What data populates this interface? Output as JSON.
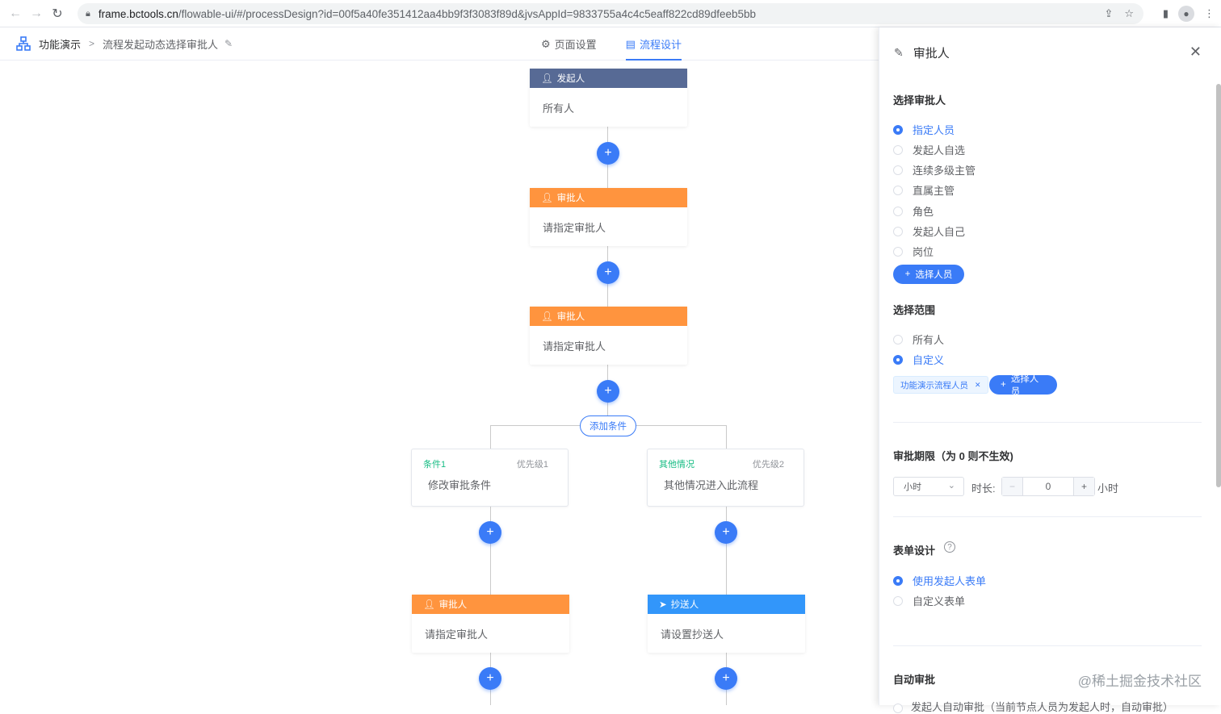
{
  "browser": {
    "url_host": "frame.bctools.cn",
    "url_rest": "/flowable-ui/#/processDesign?id=00f5a40fe351412aa4bb9f3f3083f89d&jvsAppId=9833755a4c4c5eaff822cd89dfeeb5bb"
  },
  "header": {
    "app_name": "功能演示",
    "current_page": "流程发起动态选择审批人",
    "tabs": [
      {
        "label": "页面设置",
        "icon": "gear-icon"
      },
      {
        "label": "流程设计",
        "icon": "flow-icon"
      }
    ]
  },
  "flow": {
    "start": {
      "type_label": "发起人",
      "content": "所有人"
    },
    "approver1": {
      "type_label": "审批人",
      "content": "请指定审批人"
    },
    "approver2": {
      "type_label": "审批人",
      "content": "请指定审批人"
    },
    "add_condition_label": "添加条件",
    "conditions": [
      {
        "title": "条件1",
        "priority": "优先级1",
        "content": "修改审批条件"
      },
      {
        "title": "其他情况",
        "priority": "优先级2",
        "content": "其他情况进入此流程"
      }
    ],
    "branch_left": {
      "type_label": "审批人",
      "content": "请指定审批人"
    },
    "branch_right": {
      "type_label": "抄送人",
      "content": "请设置抄送人"
    },
    "add_symbol": "+"
  },
  "panel": {
    "title": "审批人",
    "select_approver": {
      "title": "选择审批人",
      "options": [
        "指定人员",
        "发起人自选",
        "连续多级主管",
        "直属主管",
        "角色",
        "发起人自己",
        "岗位"
      ],
      "selected_index": 0,
      "button_label": "选择人员"
    },
    "select_scope": {
      "title": "选择范围",
      "options": [
        "所有人",
        "自定义"
      ],
      "selected_index": 1,
      "tag_label": "功能演示流程人员",
      "button_label": "选择人员"
    },
    "deadline": {
      "title": "审批期限（为 0 则不生效)",
      "unit_select": "小时",
      "duration_label": "时长:",
      "value": "0",
      "unit_suffix": "小时"
    },
    "form_design": {
      "title": "表单设计",
      "options": [
        "使用发起人表单",
        "自定义表单"
      ],
      "selected_index": 0
    },
    "auto_approve": {
      "title": "自动审批",
      "option_partial": "发起人自动审批（当前节点人员为发起人时，自动审批）"
    }
  },
  "watermark": "@稀土掘金技术社区"
}
